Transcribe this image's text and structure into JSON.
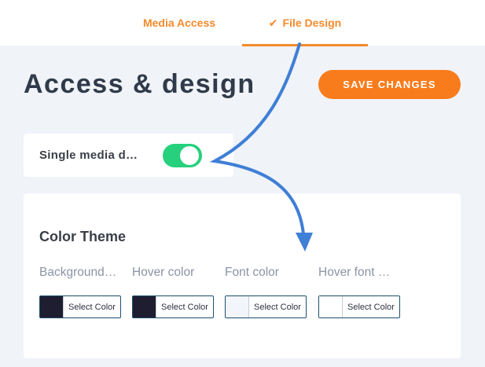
{
  "tabs": [
    {
      "label": "Media Access",
      "active": false
    },
    {
      "label": "File Design",
      "active": true,
      "icon": "check-icon"
    }
  ],
  "page": {
    "title": "Access & design"
  },
  "actions": {
    "save_label": "SAVE CHANGES"
  },
  "toggle_card": {
    "label": "Single media d…",
    "enabled": true
  },
  "color_theme": {
    "title": "Color Theme",
    "fields": [
      {
        "label": "Background…",
        "button": "Select Color",
        "swatch": "#1e1e30"
      },
      {
        "label": "Hover color",
        "button": "Select Color",
        "swatch": "#1e1e30"
      },
      {
        "label": "Font color",
        "button": "Select Color",
        "swatch": "#f2f5fc"
      },
      {
        "label": "Hover font …",
        "button": "Select Color",
        "swatch": "#ffffff"
      }
    ]
  },
  "colors": {
    "accent": "#f97c1c",
    "toggle_on": "#26d07c",
    "annotation_arrow": "#3f7fd6"
  }
}
